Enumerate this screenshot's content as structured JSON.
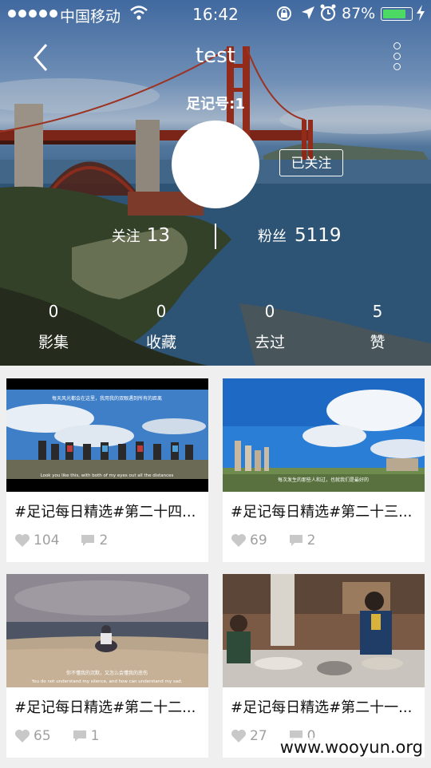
{
  "status_bar": {
    "carrier": "中国移动",
    "time": "16:42",
    "battery_percent": "87%",
    "battery_level": 0.87
  },
  "header": {
    "title": "test",
    "account_id": "足记号:1"
  },
  "follow_button": "已关注",
  "counts": {
    "following_label": "关注",
    "following": "13",
    "fans_label": "粉丝",
    "fans": "5119"
  },
  "stats": [
    {
      "value": "0",
      "label": "影集"
    },
    {
      "value": "0",
      "label": "收藏"
    },
    {
      "value": "0",
      "label": "去过"
    },
    {
      "value": "5",
      "label": "赞"
    }
  ],
  "cards": [
    {
      "title": "#足记每日精选#第二十四...",
      "likes": "104",
      "comments": "2",
      "caption_cn": "每天风光都会在这里，我用我的双眼遇到所有的距离",
      "caption_en": "Look you like this, with both of my eyes out all the distances"
    },
    {
      "title": "#足记每日精选#第二十三...",
      "likes": "69",
      "comments": "2",
      "caption_cn": "每次发生的那些人和过，也就我们是最好的",
      "caption_en": ""
    },
    {
      "title": "#足记每日精选#第二十二...",
      "likes": "65",
      "comments": "1",
      "caption_cn": "你不懂我的沉默，又怎么会懂我的悲伤",
      "caption_en": "You do not understand my silence, and how can understand my sad."
    },
    {
      "title": "#足记每日精选#第二十一...",
      "likes": "27",
      "comments": "0",
      "caption_cn": "",
      "caption_en": ""
    }
  ],
  "watermark": "www.wooyun.org",
  "colors": {
    "battery": "#4cd964",
    "like_icon": "#c8c8c8",
    "card_bg": "#ffffff",
    "page_bg": "#efefef"
  }
}
